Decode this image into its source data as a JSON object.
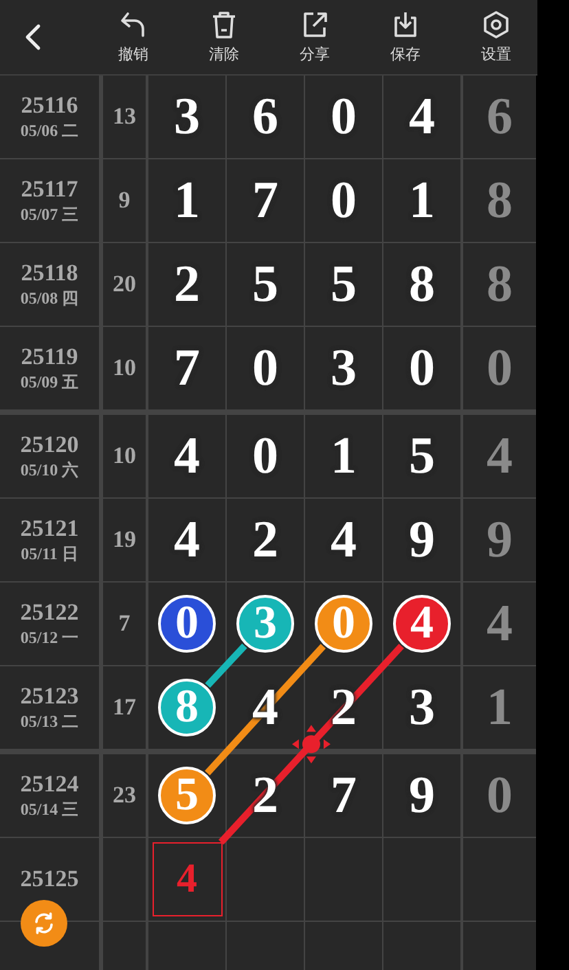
{
  "toolbar": [
    {
      "kind": "undo",
      "label": "撤销"
    },
    {
      "kind": "clear",
      "label": "清除"
    },
    {
      "kind": "share",
      "label": "分享"
    },
    {
      "kind": "save",
      "label": "保存"
    },
    {
      "kind": "settings",
      "label": "设置"
    }
  ],
  "rows": [
    {
      "issue": "25116",
      "date": "05/06 二",
      "sum": "13",
      "digits": [
        {
          "kind": "plain",
          "value": "3"
        },
        {
          "kind": "plain",
          "value": "6"
        },
        {
          "kind": "plain",
          "value": "0"
        },
        {
          "kind": "plain",
          "value": "4"
        }
      ],
      "tail": "6",
      "group_end": false
    },
    {
      "issue": "25117",
      "date": "05/07 三",
      "sum": "9",
      "digits": [
        {
          "kind": "plain",
          "value": "1"
        },
        {
          "kind": "plain",
          "value": "7"
        },
        {
          "kind": "plain",
          "value": "0"
        },
        {
          "kind": "plain",
          "value": "1"
        }
      ],
      "tail": "8",
      "group_end": false
    },
    {
      "issue": "25118",
      "date": "05/08 四",
      "sum": "20",
      "digits": [
        {
          "kind": "plain",
          "value": "2"
        },
        {
          "kind": "plain",
          "value": "5"
        },
        {
          "kind": "plain",
          "value": "5"
        },
        {
          "kind": "plain",
          "value": "8"
        }
      ],
      "tail": "8",
      "group_end": false
    },
    {
      "issue": "25119",
      "date": "05/09 五",
      "sum": "10",
      "digits": [
        {
          "kind": "plain",
          "value": "7"
        },
        {
          "kind": "plain",
          "value": "0"
        },
        {
          "kind": "plain",
          "value": "3"
        },
        {
          "kind": "plain",
          "value": "0"
        }
      ],
      "tail": "0",
      "group_end": true
    },
    {
      "issue": "25120",
      "date": "05/10 六",
      "sum": "10",
      "digits": [
        {
          "kind": "plain",
          "value": "4"
        },
        {
          "kind": "plain",
          "value": "0"
        },
        {
          "kind": "plain",
          "value": "1"
        },
        {
          "kind": "plain",
          "value": "5"
        }
      ],
      "tail": "4",
      "group_end": false
    },
    {
      "issue": "25121",
      "date": "05/11 日",
      "sum": "19",
      "digits": [
        {
          "kind": "plain",
          "value": "4"
        },
        {
          "kind": "plain",
          "value": "2"
        },
        {
          "kind": "plain",
          "value": "4"
        },
        {
          "kind": "plain",
          "value": "9"
        }
      ],
      "tail": "9",
      "group_end": false
    },
    {
      "issue": "25122",
      "date": "05/12 一",
      "sum": "7",
      "digits": [
        {
          "kind": "ball",
          "value": "0",
          "color": "#2a4fd8"
        },
        {
          "kind": "ball",
          "value": "3",
          "color": "#17b6b6"
        },
        {
          "kind": "ball",
          "value": "0",
          "color": "#f28c16"
        },
        {
          "kind": "ball",
          "value": "4",
          "color": "#e8202c"
        }
      ],
      "tail": "4",
      "group_end": false
    },
    {
      "issue": "25123",
      "date": "05/13 二",
      "sum": "17",
      "digits": [
        {
          "kind": "ball",
          "value": "8",
          "color": "#17b6b6"
        },
        {
          "kind": "plain",
          "value": "4"
        },
        {
          "kind": "plain",
          "value": "2"
        },
        {
          "kind": "plain",
          "value": "3"
        }
      ],
      "tail": "1",
      "group_end": true
    },
    {
      "issue": "25124",
      "date": "05/14 三",
      "sum": "23",
      "digits": [
        {
          "kind": "ball",
          "value": "5",
          "color": "#f28c16"
        },
        {
          "kind": "plain",
          "value": "2"
        },
        {
          "kind": "plain",
          "value": "7"
        },
        {
          "kind": "plain",
          "value": "9"
        }
      ],
      "tail": "0",
      "group_end": false
    },
    {
      "issue": "25125",
      "digits": [
        {
          "kind": "pick",
          "value": "4",
          "color": "#e8202c"
        },
        {
          "kind": "empty"
        },
        {
          "kind": "empty"
        },
        {
          "kind": "empty"
        }
      ],
      "group_end": false
    }
  ]
}
